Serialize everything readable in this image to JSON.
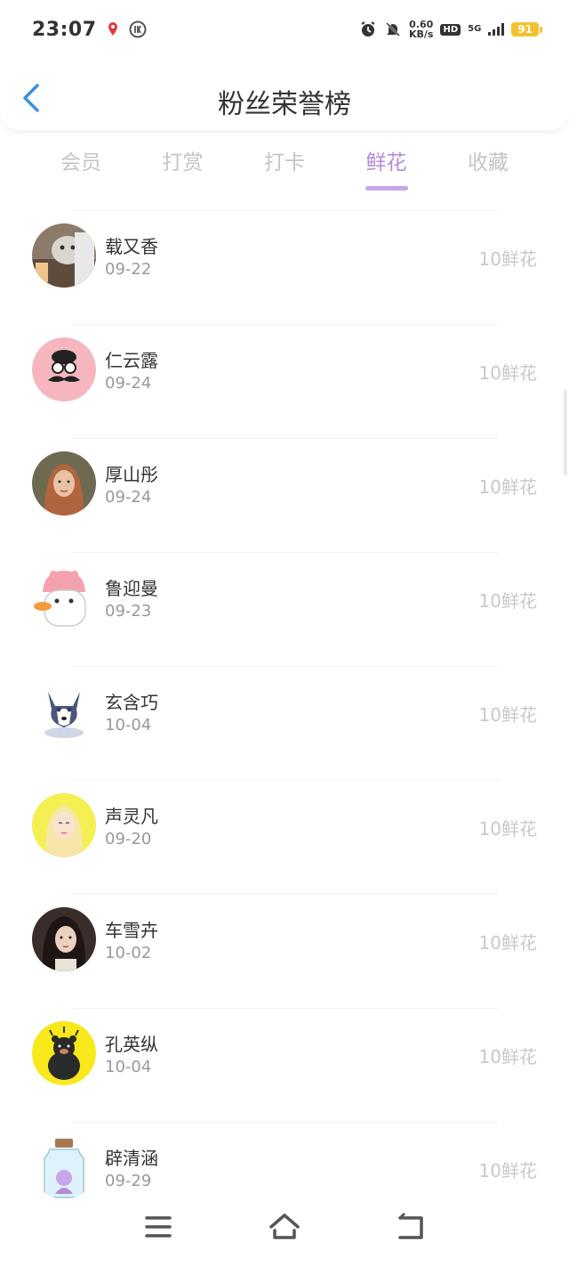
{
  "status_bar": {
    "time": "23:07",
    "speed_value": "0.60",
    "speed_unit": "KB/s",
    "hd": "HD",
    "network": "5G",
    "battery": "91"
  },
  "header": {
    "title": "粉丝荣誉榜"
  },
  "tabs": [
    {
      "label": "会员",
      "active": false
    },
    {
      "label": "打赏",
      "active": false
    },
    {
      "label": "打卡",
      "active": false
    },
    {
      "label": "鲜花",
      "active": true
    },
    {
      "label": "收藏",
      "active": false
    }
  ],
  "fans": [
    {
      "name": "载又香",
      "date": "09-22",
      "amount": "10鲜花"
    },
    {
      "name": "仁云露",
      "date": "09-24",
      "amount": "10鲜花"
    },
    {
      "name": "厚山彤",
      "date": "09-24",
      "amount": "10鲜花"
    },
    {
      "name": "鲁迎曼",
      "date": "09-23",
      "amount": "10鲜花"
    },
    {
      "name": "玄含巧",
      "date": "10-04",
      "amount": "10鲜花"
    },
    {
      "name": "声灵凡",
      "date": "09-20",
      "amount": "10鲜花"
    },
    {
      "name": "车雪卉",
      "date": "10-02",
      "amount": "10鲜花"
    },
    {
      "name": "孔英纵",
      "date": "10-04",
      "amount": "10鲜花"
    },
    {
      "name": "辟清涵",
      "date": "09-29",
      "amount": "10鲜花"
    }
  ],
  "colors": {
    "accent": "#b48bd8",
    "back_arrow": "#3d8fe0",
    "battery": "#f2c230"
  }
}
